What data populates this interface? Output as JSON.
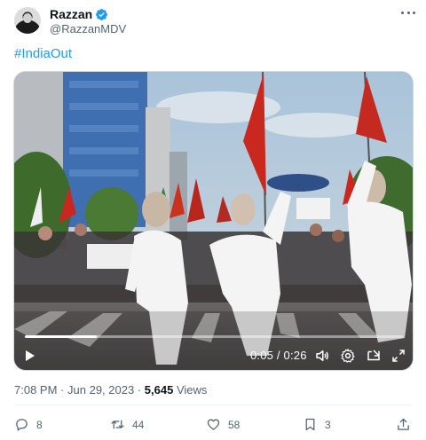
{
  "author": {
    "name": "Razzan",
    "handle": "@RazzanMDV"
  },
  "post": {
    "text": "#IndiaOut"
  },
  "video": {
    "current_time": "0:05",
    "duration": "0:26",
    "progress": 0.19
  },
  "meta": {
    "time": "7:08 PM",
    "separator": "·",
    "date": "Jun 29, 2023",
    "separator2": "·",
    "views_count": "5,645",
    "views_label": "Views"
  },
  "actions": {
    "replies": "8",
    "reposts": "44",
    "likes": "58",
    "bookmarks": "3"
  },
  "colors": {
    "accent": "#1d9bf0",
    "text_secondary": "#536471",
    "text_primary": "#0f1419"
  },
  "icons": [
    "verified-badge-icon",
    "more-icon",
    "play-icon",
    "volume-icon",
    "settings-icon",
    "pip-icon",
    "fullscreen-icon",
    "reply-icon",
    "repost-icon",
    "like-icon",
    "bookmark-icon",
    "share-icon"
  ]
}
